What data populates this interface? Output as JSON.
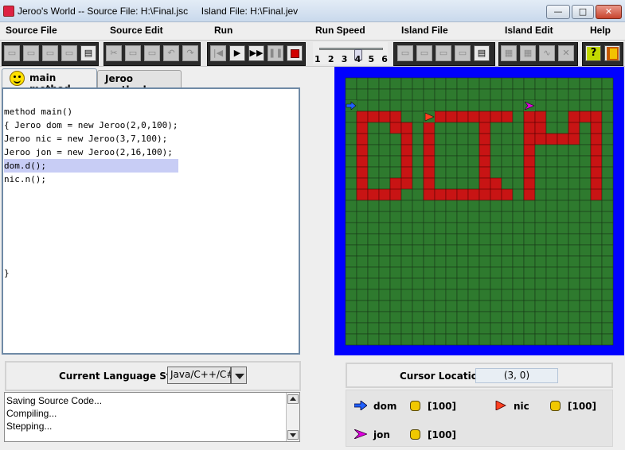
{
  "window": {
    "title": "Jeroo's World -- Source File: H:\\Final.jsc     Island File: H:\\Final.jev",
    "minimize_label": "—",
    "maximize_label": "□",
    "close_label": "✕"
  },
  "menu": [
    {
      "label": "Source File"
    },
    {
      "label": "Source Edit"
    },
    {
      "label": "Run"
    },
    {
      "label": "Run Speed"
    },
    {
      "label": "Island File"
    },
    {
      "label": "Island Edit"
    },
    {
      "label": "Help"
    }
  ],
  "toolbar": {
    "source_buttons": [
      "new-file-icon",
      "open-file-icon",
      "save-icon",
      "save-as-icon",
      "print-icon"
    ],
    "edit_buttons": [
      "cut-icon",
      "copy-icon",
      "paste-icon",
      "undo-icon",
      "redo-icon"
    ],
    "run_buttons": [
      {
        "name": "reset-icon",
        "glyph": "|◀",
        "active": false
      },
      {
        "name": "step-icon",
        "glyph": "▶",
        "active": true
      },
      {
        "name": "run-icon",
        "glyph": "▶▶",
        "active": true
      },
      {
        "name": "pause-icon",
        "glyph": "❚❚",
        "active": false
      },
      {
        "name": "stop-icon",
        "glyph": "■",
        "active": true
      }
    ],
    "island_buttons": [
      "new-island-icon",
      "open-island-icon",
      "save-island-icon",
      "save-island-as-icon",
      "print-island-icon"
    ],
    "island_edit_buttons": [
      "clear-island-icon",
      "grid-icon",
      "path-icon",
      "erase-icon"
    ],
    "speed": {
      "labels": [
        "1",
        "2",
        "3",
        "4",
        "5",
        "6"
      ],
      "value": 4
    }
  },
  "tabs": {
    "main": "main method",
    "methods": "Jeroo methods"
  },
  "editor": {
    "lines": [
      {
        "text": "method main()",
        "highlight": false
      },
      {
        "text": "{ Jeroo dom = new Jeroo(2,0,100);",
        "highlight": false
      },
      {
        "text": "Jeroo nic = new Jeroo(3,7,100);",
        "highlight": false
      },
      {
        "text": "Jeroo jon = new Jeroo(2,16,100);",
        "highlight": false
      },
      {
        "text": "dom.d();",
        "highlight": true
      },
      {
        "text": "nic.n();",
        "highlight": false
      }
    ],
    "closing": "}"
  },
  "language": {
    "label": "Current Language Style",
    "value": "Java/C++/C#"
  },
  "messages": [
    "Saving Source Code...",
    "Compiling...",
    "Stepping..."
  ],
  "island": {
    "rows": 24,
    "cols": 24,
    "colors": {
      "water": "#0000ff",
      "grass": "#2e7a2e",
      "net": "#c81414"
    },
    "nets": [
      [
        3,
        1
      ],
      [
        3,
        2
      ],
      [
        3,
        3
      ],
      [
        3,
        4
      ],
      [
        4,
        1
      ],
      [
        5,
        1
      ],
      [
        6,
        1
      ],
      [
        7,
        1
      ],
      [
        8,
        1
      ],
      [
        9,
        1
      ],
      [
        10,
        1
      ],
      [
        10,
        2
      ],
      [
        10,
        3
      ],
      [
        4,
        4
      ],
      [
        4,
        5
      ],
      [
        5,
        5
      ],
      [
        6,
        5
      ],
      [
        7,
        5
      ],
      [
        8,
        5
      ],
      [
        9,
        5
      ],
      [
        9,
        4
      ],
      [
        10,
        4
      ],
      [
        3,
        8
      ],
      [
        3,
        9
      ],
      [
        3,
        10
      ],
      [
        3,
        11
      ],
      [
        3,
        12
      ],
      [
        3,
        13
      ],
      [
        3,
        14
      ],
      [
        4,
        7
      ],
      [
        5,
        7
      ],
      [
        6,
        7
      ],
      [
        7,
        7
      ],
      [
        8,
        7
      ],
      [
        9,
        7
      ],
      [
        10,
        7
      ],
      [
        10,
        8
      ],
      [
        10,
        9
      ],
      [
        10,
        10
      ],
      [
        10,
        11
      ],
      [
        10,
        12
      ],
      [
        10,
        13
      ],
      [
        10,
        14
      ],
      [
        4,
        12
      ],
      [
        5,
        12
      ],
      [
        6,
        12
      ],
      [
        7,
        12
      ],
      [
        8,
        12
      ],
      [
        9,
        12
      ],
      [
        9,
        13
      ],
      [
        3,
        16
      ],
      [
        3,
        17
      ],
      [
        4,
        16
      ],
      [
        5,
        16
      ],
      [
        6,
        16
      ],
      [
        7,
        16
      ],
      [
        8,
        16
      ],
      [
        9,
        16
      ],
      [
        10,
        16
      ],
      [
        4,
        17
      ],
      [
        5,
        17
      ],
      [
        5,
        18
      ],
      [
        5,
        19
      ],
      [
        3,
        20
      ],
      [
        3,
        21
      ],
      [
        3,
        22
      ],
      [
        4,
        20
      ],
      [
        5,
        20
      ],
      [
        4,
        22
      ],
      [
        5,
        22
      ],
      [
        6,
        22
      ],
      [
        7,
        22
      ],
      [
        8,
        22
      ],
      [
        9,
        22
      ],
      [
        10,
        22
      ]
    ],
    "jeroos": [
      {
        "name": "dom",
        "row": 2,
        "col": 0,
        "dir": "E",
        "color": "#2060ff"
      },
      {
        "name": "nic",
        "row": 3,
        "col": 7,
        "dir": "E",
        "color": "#ff4020"
      },
      {
        "name": "jon",
        "row": 2,
        "col": 16,
        "dir": "E",
        "color": "#e000e0"
      }
    ]
  },
  "cursor": {
    "label": "Cursor Location",
    "value": "(3, 0)"
  },
  "jeroo_status": [
    {
      "name": "dom",
      "flowers": "[100]",
      "color": "#2060ff"
    },
    {
      "name": "nic",
      "flowers": "[100]",
      "color": "#ff4020"
    },
    {
      "name": "jon",
      "flowers": "[100]",
      "color": "#e000e0"
    }
  ]
}
